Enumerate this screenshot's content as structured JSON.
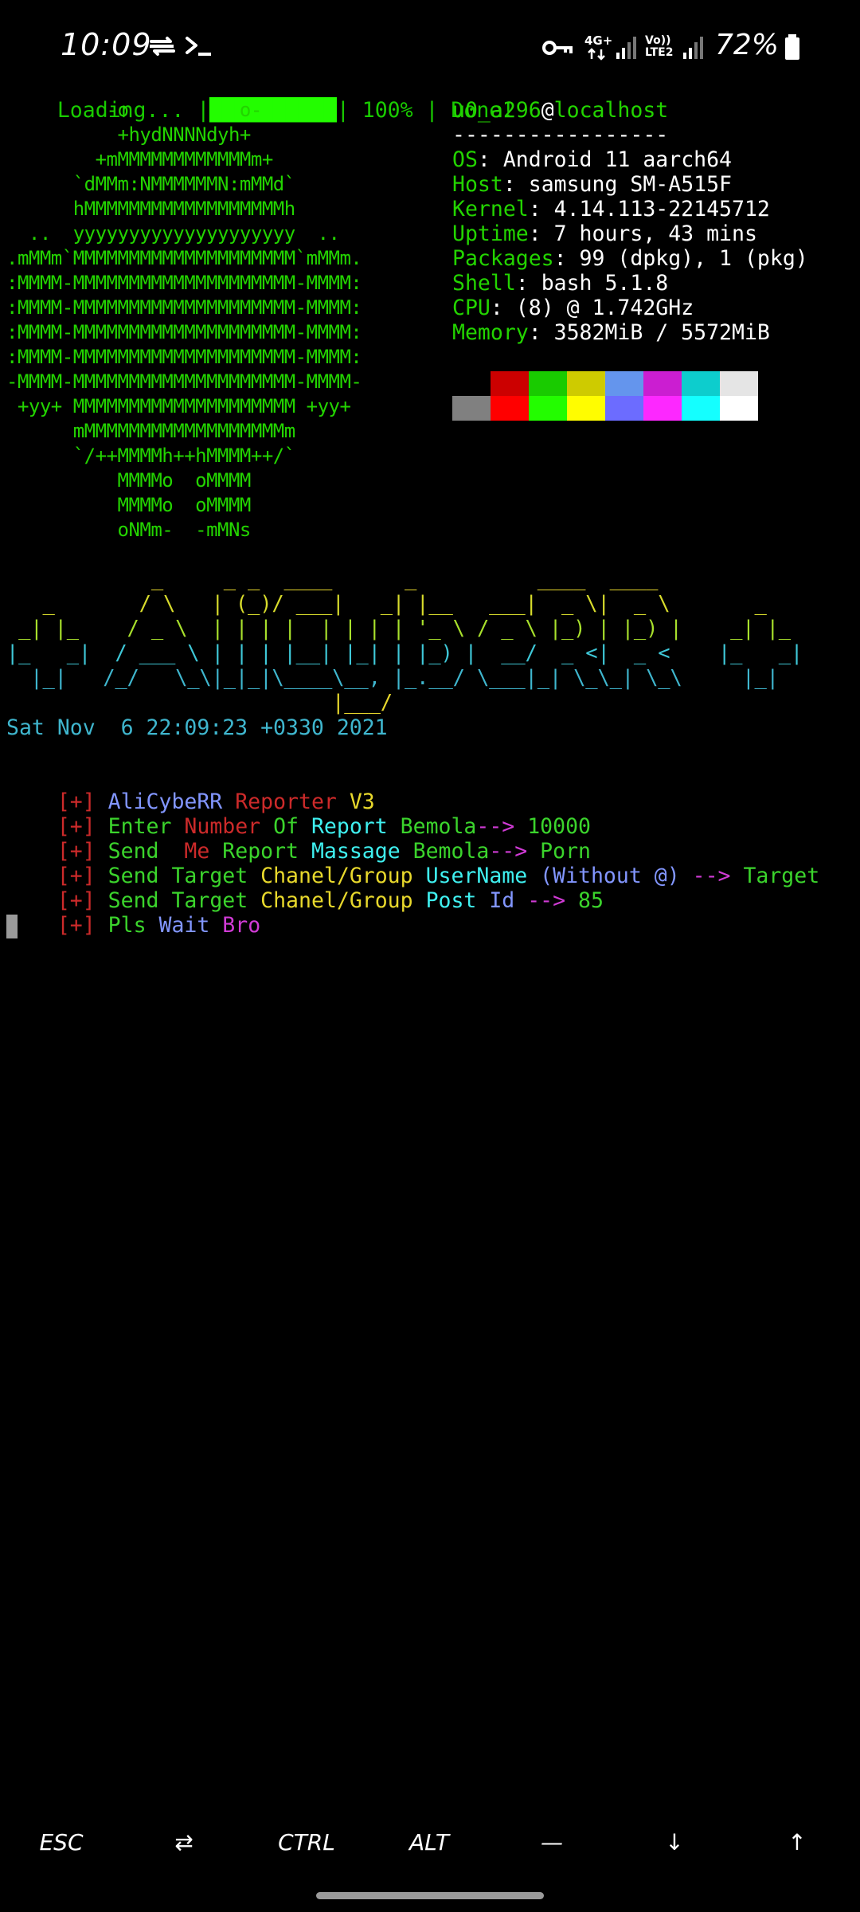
{
  "status_bar": {
    "time": "10:09",
    "net_4g": "4G+",
    "volte": "Vo)) LTE2",
    "battery": "72%",
    "icons": [
      "sync-icon",
      "terminal-icon",
      "vpn-key-icon",
      "data-arrows-icon",
      "signal-icon",
      "signal-icon",
      "battery-icon"
    ]
  },
  "terminal": {
    "loading": {
      "prefix": "Loading... |",
      "bar": "██████████",
      "suffix": "| 100% | Done!"
    },
    "logo": [
      "         -o          o-",
      "          +hydNNNNdyh+",
      "        +mMMMMMMMMMMMMm+",
      "      `dMMm:NMMMMMMN:mMMd`",
      "      hMMMMMMMMMMMMMMMMMMh",
      "  ..  yyyyyyyyyyyyyyyyyyyy  ..",
      ".mMMm`MMMMMMMMMMMMMMMMMMMM`mMMm.",
      ":MMMM-MMMMMMMMMMMMMMMMMMMM-MMMM:",
      ":MMMM-MMMMMMMMMMMMMMMMMMMM-MMMM:",
      ":MMMM-MMMMMMMMMMMMMMMMMMMM-MMMM:",
      ":MMMM-MMMMMMMMMMMMMMMMMMMM-MMMM:",
      "-MMMM-MMMMMMMMMMMMMMMMMMMM-MMMM-",
      " +yy+ MMMMMMMMMMMMMMMMMMMM +yy+",
      "      mMMMMMMMMMMMMMMMMMMm",
      "      `/++MMMMh++hMMMM++/`",
      "          MMMMo  oMMMM",
      "          MMMMo  oMMMM",
      "          oNMm-  -mMNs"
    ],
    "info": {
      "user": "u0_a296",
      "at": "@",
      "host": "localhost",
      "separator": "-----------------",
      "rows": [
        {
          "key": "OS",
          "value": ": Android 11 aarch64"
        },
        {
          "key": "Host",
          "value": ": samsung SM-A515F"
        },
        {
          "key": "Kernel",
          "value": ": 4.14.113-22145712"
        },
        {
          "key": "Uptime",
          "value": ": 7 hours, 43 mins"
        },
        {
          "key": "Packages",
          "value": ": 99 (dpkg), 1 (pkg)"
        },
        {
          "key": "Shell",
          "value": ": bash 5.1.8"
        },
        {
          "key": "CPU",
          "value": ": (8) @ 1.742GHz"
        },
        {
          "key": "Memory",
          "value": ": 3582MiB / 5572MiB"
        }
      ]
    },
    "palette": {
      "row1": [
        "#000000",
        "#cc0000",
        "#19cb00",
        "#cecb00",
        "#6495ed",
        "#cb1ed1",
        "#0dcdcd",
        "#e5e5e5"
      ],
      "row2": [
        "#808080",
        "#ff0000",
        "#23fd00",
        "#fffd00",
        "#6c6cff",
        "#fd28ff",
        "#14ffff",
        "#ffffff"
      ]
    },
    "banner": [
      "            _     _ _  ____      _          ____  ____",
      "   _       / \\   | (_)/ ___|   _| |__   ___|  _ \\|  _ \\       _",
      " _| |_    / _ \\  | | | |  | | | | '_ \\ / _ \\ |_) | |_) |    _| |_",
      "|_   _|  / ___ \\ | | | |__| |_| | |_) |  __/  _ <|  _ <    |_   _|",
      "  |_|   /_/   \\_\\|_|_|\\____\\__, |_.__/ \\___|_| \\_\\_| \\_\\     |_|",
      "                           |___/"
    ],
    "date": "Sat Nov  6 22:09:23 +0330 2021",
    "prompt_tag": "[+]",
    "lines": [
      {
        "parts": [
          "AliCybeRR",
          " Reporter",
          " V3"
        ]
      },
      {
        "parts": [
          "Enter",
          " Number",
          " Of",
          " Report",
          " Bemola",
          "-->",
          " 10000"
        ]
      },
      {
        "parts": [
          "Send",
          "  Me",
          " Report",
          " Massage",
          " Bemola",
          "-->",
          " Porn"
        ]
      },
      {
        "parts": [
          "Send",
          " Target",
          " Chanel/Group",
          " UserName",
          " (Without @)",
          " -->",
          " Target"
        ]
      },
      {
        "parts": [
          "Send",
          " Target",
          " Chanel/Group",
          " Post",
          " Id",
          " -->",
          " 85"
        ]
      },
      {
        "parts": [
          "Pls",
          " Wait",
          " Bro"
        ]
      }
    ]
  },
  "extra_keys": [
    "ESC",
    "⇄",
    "CTRL",
    "ALT",
    "—",
    "↓",
    "↑"
  ]
}
